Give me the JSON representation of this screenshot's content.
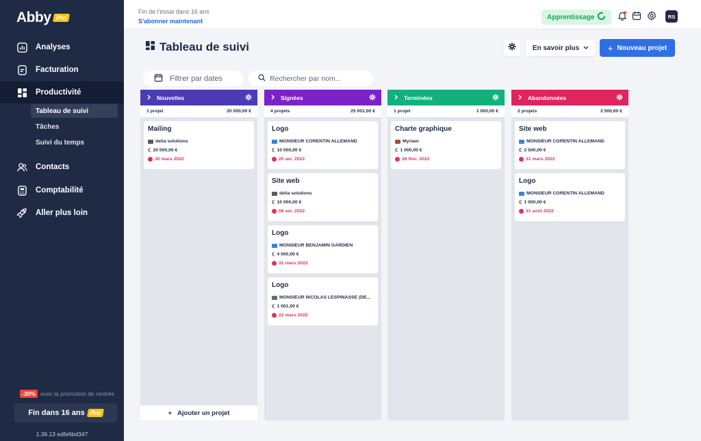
{
  "brand": {
    "name": "Abby",
    "badge": "Pro"
  },
  "sidebar": {
    "items": [
      {
        "label": "Analyses",
        "icon": "chart-icon"
      },
      {
        "label": "Facturation",
        "icon": "invoice-icon"
      },
      {
        "label": "Productivité",
        "icon": "dashboard-icon"
      },
      {
        "label": "Contacts",
        "icon": "contacts-icon"
      },
      {
        "label": "Comptabilité",
        "icon": "calculator-icon"
      },
      {
        "label": "Aller plus loin",
        "icon": "rocket-icon"
      }
    ],
    "subitems": [
      {
        "label": "Tableau de suivi"
      },
      {
        "label": "Tâches"
      },
      {
        "label": "Suivi du temps"
      }
    ],
    "promo_pct": "-30%",
    "promo_text": "avec la promotion de rentrée",
    "trial_button": "Fin dans 16 ans",
    "trial_badge": "Pro",
    "version": "1.36.13 edfe6bd347"
  },
  "topbar": {
    "trial_text": "Fin de l'essai dans 16 ans",
    "subscribe": "S'abonner maintenant",
    "learning": "Apprentissage",
    "avatar": "RS"
  },
  "header": {
    "title": "Tableau de suivi",
    "learn_more": "En savoir plus",
    "new_project": "Nouveau projet"
  },
  "filters": {
    "dates": "Filtrer par dates",
    "search_placeholder": "Rechercher par nom..."
  },
  "columns": [
    {
      "name": "Nouvelles",
      "color": "#4b3bb5",
      "count": "1 projet",
      "total": "20 000,00 €",
      "cards": [
        {
          "title": "Mailing",
          "client": "delia solutions",
          "client_color": "#5c5c5c",
          "amount": "20 000,00 €",
          "date": "30 mars 2022"
        }
      ],
      "add_label": "Ajouter un projet"
    },
    {
      "name": "Signées",
      "color": "#7b22c8",
      "count": "4 projets",
      "total": "25 001,00 €",
      "cards": [
        {
          "title": "Logo",
          "client": "MONSIEUR CORENTIN ALLEMAND",
          "client_color": "#3b82d6",
          "amount": "10 000,00 €",
          "date": "20 avr. 2022"
        },
        {
          "title": "Site web",
          "client": "delia solutions",
          "client_color": "#5c5c5c",
          "amount": "10 000,00 €",
          "date": "08 avr. 2022"
        },
        {
          "title": "Logo",
          "client": "MONSIEUR BENJAMIN GARDIEN",
          "client_color": "#3b82d6",
          "amount": "4 000,00 €",
          "date": "31 mars 2022"
        },
        {
          "title": "Logo",
          "client": "MONSIEUR NICOLAS LESPINASSE (DE...",
          "client_color": "#6b6b6b",
          "amount": "1 001,00 €",
          "date": "22 mars 2022"
        }
      ]
    },
    {
      "name": "Terminées",
      "color": "#12b07a",
      "count": "1 projet",
      "total": "1 000,00 €",
      "cards": [
        {
          "title": "Charte graphique",
          "client": "Myriam",
          "client_color": "#a0522d",
          "amount": "1 000,00 €",
          "date": "26 févr. 2022"
        }
      ]
    },
    {
      "name": "Abandonnées",
      "color": "#e0245e",
      "count": "2 projets",
      "total": "3 500,00 €",
      "cards": [
        {
          "title": "Site web",
          "client": "MONSIEUR CORENTIN ALLEMAND",
          "client_color": "#3b82d6",
          "amount": "2 500,00 €",
          "date": "31 mars 2022"
        },
        {
          "title": "Logo",
          "client": "MONSIEUR CORENTIN ALLEMAND",
          "client_color": "#3b82d6",
          "amount": "1 000,00 €",
          "date": "31 août 2022"
        }
      ]
    }
  ]
}
